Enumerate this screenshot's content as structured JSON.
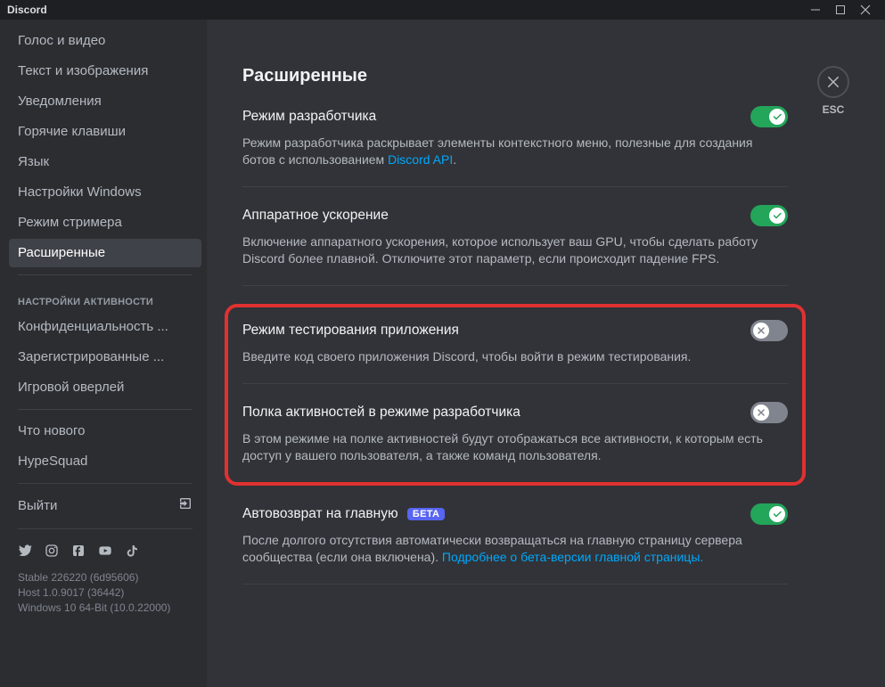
{
  "titlebar": {
    "app": "Discord"
  },
  "close": {
    "esc": "ESC"
  },
  "sidebar": {
    "items1": [
      "Голос и видео",
      "Текст и изображения",
      "Уведомления",
      "Горячие клавиши",
      "Язык",
      "Настройки Windows",
      "Режим стримера",
      "Расширенные"
    ],
    "header2": "НАСТРОЙКИ АКТИВНОСТИ",
    "items2": [
      "Конфиденциальность ...",
      "Зарегистрированные ...",
      "Игровой оверлей"
    ],
    "items3": [
      "Что нового",
      "HypeSquad"
    ],
    "logout": "Выйти"
  },
  "version": {
    "l1": "Stable 226220 (6d95606)",
    "l2": "Host 1.0.9017 (36442)",
    "l3": "Windows 10 64-Bit (10.0.22000)"
  },
  "page": {
    "title": "Расширенные"
  },
  "settings": {
    "dev": {
      "title": "Режим разработчика",
      "desc_pre": "Режим разработчика раскрывает элементы контекстного меню, полезные для создания ботов с использованием ",
      "link": "Discord API",
      "desc_post": "."
    },
    "hw": {
      "title": "Аппаратное ускорение",
      "desc": "Включение аппаратного ускорения, которое использует ваш GPU, чтобы сделать работу Discord более плавной. Отключите этот параметр, если происходит падение FPS."
    },
    "test": {
      "title": "Режим тестирования приложения",
      "desc": "Введите код своего приложения Discord, чтобы войти в режим тестирования."
    },
    "shelf": {
      "title": "Полка активностей в режиме разработчика",
      "desc": "В этом режиме на полке активностей будут отображаться все активности, к которым есть доступ у вашего пользователя, а также команд пользователя."
    },
    "autoret": {
      "title": "Автовозврат на главную",
      "beta": "БЕТА",
      "desc_pre": "После долгого отсутствия автоматически возвращаться на главную страницу сервера сообщества (если она включена). ",
      "link": "Подробнее о бета-версии главной страницы."
    }
  }
}
